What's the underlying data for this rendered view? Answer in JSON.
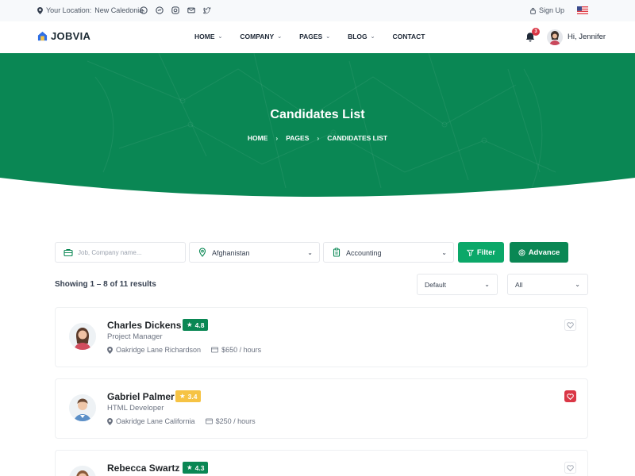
{
  "topbar": {
    "location_label": "Your Location:",
    "location_value": "New Caledonia",
    "socials": [
      "whatsapp-icon",
      "messenger-icon",
      "instagram-icon",
      "email-icon",
      "twitter-icon"
    ],
    "sign_up": "Sign Up",
    "language_flag": "us-flag-icon"
  },
  "navbar": {
    "brand": "JOBVIA",
    "items": [
      {
        "label": "HOME",
        "dropdown": true
      },
      {
        "label": "COMPANY",
        "dropdown": true
      },
      {
        "label": "PAGES",
        "dropdown": true
      },
      {
        "label": "BLOG",
        "dropdown": true
      },
      {
        "label": "CONTACT",
        "dropdown": false
      }
    ],
    "notification_count": "3",
    "greeting": "Hi, Jennifer"
  },
  "hero": {
    "title": "Candidates List",
    "breadcrumb": [
      "HOME",
      "PAGES",
      "CANDIDATES LIST"
    ]
  },
  "search": {
    "job_placeholder": "Job, Company name...",
    "location_value": "Afghanistan",
    "category_value": "Accounting",
    "filter_label": "Filter",
    "advance_label": "Advance"
  },
  "results": {
    "summary": "Showing 1 – 8 of 11 results",
    "sort_value": "Default",
    "scope_value": "All"
  },
  "candidates": [
    {
      "name": "Charles Dickens",
      "rating": "4.8",
      "rating_color": "#0a8754",
      "role": "Project Manager",
      "location": "Oakridge Lane Richardson",
      "rate": "$650 / hours",
      "favorite": false
    },
    {
      "name": "Gabriel Palmer",
      "rating": "3.4",
      "rating_color": "#f6c344",
      "role": "HTML Developer",
      "location": "Oakridge Lane California",
      "rate": "$250 / hours",
      "favorite": true
    },
    {
      "name": "Rebecca Swartz",
      "rating": "4.3",
      "rating_color": "#0a8754",
      "role": "",
      "location": "",
      "rate": "",
      "favorite": false
    }
  ],
  "colors": {
    "primary": "#0a8754",
    "accent": "#0ba869",
    "danger": "#da3746",
    "warning": "#f6c344"
  }
}
